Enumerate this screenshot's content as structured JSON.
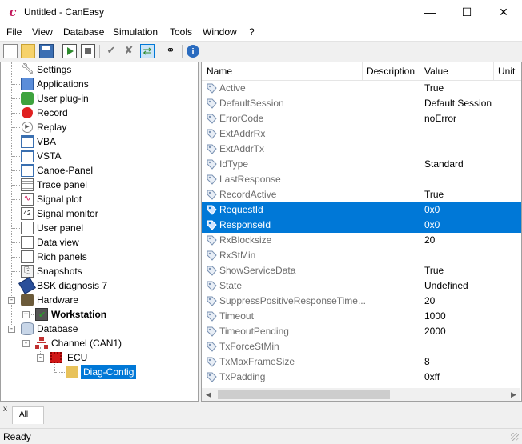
{
  "window": {
    "title": "Untitled - CanEasy",
    "app_icon": "canEasy-app-icon",
    "controls": {
      "minimize": "—",
      "maximize": "☐",
      "close": "✕"
    }
  },
  "menu": [
    {
      "label": "File"
    },
    {
      "label": "View"
    },
    {
      "label": "Database"
    },
    {
      "label": "Simulation"
    },
    {
      "label": "Tools"
    },
    {
      "label": "Window"
    },
    {
      "label": "?"
    }
  ],
  "toolbar": {
    "buttons": [
      "new-icon",
      "open-icon",
      "save-icon",
      "start-icon",
      "stop-icon",
      "check-icon",
      "uncheck-icon",
      "refresh-icon",
      "binoculars-icon",
      "info-icon"
    ]
  },
  "tree": {
    "items": [
      {
        "label": "Settings",
        "icon": "wrench-icon"
      },
      {
        "label": "Applications",
        "icon": "applications-icon"
      },
      {
        "label": "User plug-in",
        "icon": "puzzle-icon"
      },
      {
        "label": "Record",
        "icon": "record-icon"
      },
      {
        "label": "Replay",
        "icon": "replay-icon"
      },
      {
        "label": "VBA",
        "icon": "window-icon"
      },
      {
        "label": "VSTA",
        "icon": "window-icon"
      },
      {
        "label": "Canoe-Panel",
        "icon": "window-icon"
      },
      {
        "label": "Trace panel",
        "icon": "trace-icon"
      },
      {
        "label": "Signal plot",
        "icon": "plot-icon"
      },
      {
        "label": "Signal monitor",
        "icon": "monitor-icon"
      },
      {
        "label": "User panel",
        "icon": "panel-icon"
      },
      {
        "label": "Data view",
        "icon": "panel-icon"
      },
      {
        "label": "Rich panels",
        "icon": "panel-icon"
      },
      {
        "label": "Snapshots",
        "icon": "snapshot-icon"
      },
      {
        "label": "BSK diagnosis 7",
        "icon": "diagnosis-icon"
      },
      {
        "label": "Hardware",
        "icon": "hardware-icon",
        "expander": "-"
      },
      {
        "label": "Workstation",
        "icon": "workstation-icon",
        "expander": "+",
        "bold": true
      },
      {
        "label": "Database",
        "icon": "database-icon",
        "expander": "-"
      },
      {
        "label": "Channel (CAN1)",
        "icon": "network-icon",
        "expander": "-"
      },
      {
        "label": "ECU",
        "icon": "ecu-icon",
        "expander": "-"
      },
      {
        "label": "Diag-Config",
        "icon": "package-icon",
        "selected": true
      }
    ]
  },
  "grid": {
    "columns": {
      "name": "Name",
      "description": "Description",
      "value": "Value",
      "unit": "Unit"
    },
    "rows": [
      {
        "name": "Active",
        "value": "True"
      },
      {
        "name": "DefaultSession",
        "value": "Default Session"
      },
      {
        "name": "ErrorCode",
        "value": "noError"
      },
      {
        "name": "ExtAddrRx",
        "value": ""
      },
      {
        "name": "ExtAddrTx",
        "value": ""
      },
      {
        "name": "IdType",
        "value": "Standard"
      },
      {
        "name": "LastResponse",
        "value": ""
      },
      {
        "name": "RecordActive",
        "value": "True"
      },
      {
        "name": "RequestId",
        "value": "0x0",
        "selected": true
      },
      {
        "name": "ResponseId",
        "value": "0x0",
        "selected": true
      },
      {
        "name": "RxBlocksize",
        "value": "20"
      },
      {
        "name": "RxStMin",
        "value": ""
      },
      {
        "name": "ShowServiceData",
        "value": "True"
      },
      {
        "name": "State",
        "value": "Undefined"
      },
      {
        "name": "SuppressPositiveResponseTime...",
        "value": "20"
      },
      {
        "name": "Timeout",
        "value": "1000"
      },
      {
        "name": "TimeoutPending",
        "value": "2000"
      },
      {
        "name": "TxForceStMin",
        "value": ""
      },
      {
        "name": "TxMaxFrameSize",
        "value": "8"
      },
      {
        "name": "TxPadding",
        "value": "0xff"
      }
    ]
  },
  "tabs": {
    "close": "x",
    "items": [
      {
        "label": "All"
      }
    ]
  },
  "status": {
    "text": "Ready"
  },
  "colors": {
    "selection": "#0078d7",
    "accent_app_icon": "#c2185b"
  }
}
